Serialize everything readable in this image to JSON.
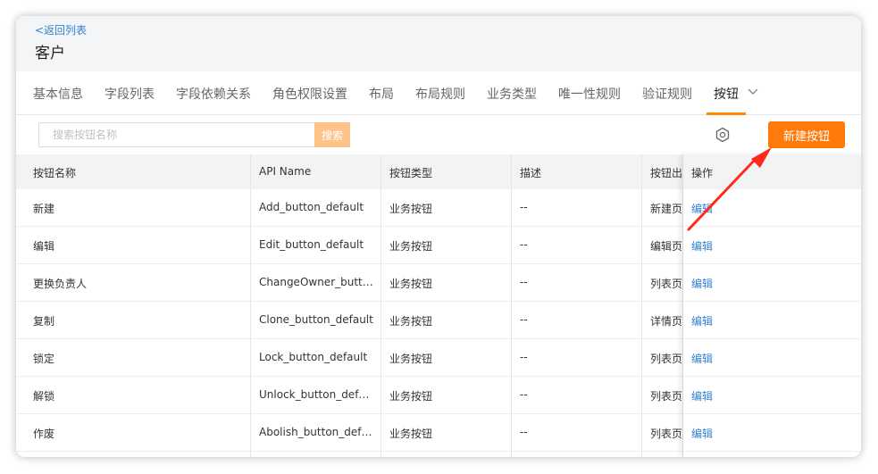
{
  "header": {
    "back_label": "<返回列表",
    "title": "客户"
  },
  "tabs": [
    {
      "label": "基本信息"
    },
    {
      "label": "字段列表"
    },
    {
      "label": "字段依赖关系"
    },
    {
      "label": "角色权限设置"
    },
    {
      "label": "布局"
    },
    {
      "label": "布局规则"
    },
    {
      "label": "业务类型"
    },
    {
      "label": "唯一性规则"
    },
    {
      "label": "验证规则"
    },
    {
      "label": "按钮"
    }
  ],
  "toolbar": {
    "search_placeholder": "搜索按钮名称",
    "search_label": "搜索",
    "new_button_label": "新建按钮"
  },
  "table": {
    "columns": [
      "按钮名称",
      "API Name",
      "按钮类型",
      "描述",
      "按钮出",
      "操作"
    ],
    "rows": [
      [
        "新建",
        "Add_button_default",
        "业务按钮",
        "--",
        "新建页",
        "编辑"
      ],
      [
        "编辑",
        "Edit_button_default",
        "业务按钮",
        "--",
        "编辑页",
        "编辑"
      ],
      [
        "更换负责人",
        "ChangeOwner_butto…",
        "业务按钮",
        "--",
        "列表页",
        "编辑"
      ],
      [
        "复制",
        "Clone_button_default",
        "业务按钮",
        "--",
        "详情页",
        "编辑"
      ],
      [
        "锁定",
        "Lock_button_default",
        "业务按钮",
        "--",
        "列表页",
        "编辑"
      ],
      [
        "解锁",
        "Unlock_button_default",
        "业务按钮",
        "--",
        "列表页",
        "编辑"
      ],
      [
        "作废",
        "Abolish_button_default",
        "业务按钮",
        "--",
        "列表页",
        "编辑"
      ]
    ]
  },
  "colors": {
    "accent": "#ff7a0a",
    "link": "#2f83d6",
    "annotation_arrow": "#ff2a1a"
  }
}
